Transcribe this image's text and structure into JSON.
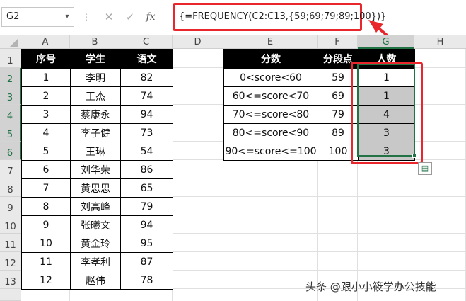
{
  "formula_bar": {
    "name_box": "G2",
    "name_box_arrow": "▾",
    "dots": "⋮",
    "cancel_icon": "✕",
    "enter_icon": "✓",
    "fx_label": "fx",
    "formula": "{=FREQUENCY(C2:C13,{59;69;79;89;100})}"
  },
  "columns": [
    "A",
    "B",
    "C",
    "D",
    "E",
    "F",
    "G",
    "H"
  ],
  "rows": [
    "1",
    "2",
    "3",
    "4",
    "5",
    "6",
    "7",
    "8",
    "9",
    "10",
    "11",
    "12",
    "13"
  ],
  "score_table": {
    "headers": [
      "序号",
      "学生",
      "语文"
    ],
    "rows": [
      [
        "1",
        "李明",
        "82"
      ],
      [
        "2",
        "王杰",
        "74"
      ],
      [
        "3",
        "蔡康永",
        "94"
      ],
      [
        "4",
        "李子健",
        "73"
      ],
      [
        "5",
        "王琳",
        "54"
      ],
      [
        "6",
        "刘华荣",
        "86"
      ],
      [
        "7",
        "黄思思",
        "65"
      ],
      [
        "8",
        "刘高峰",
        "79"
      ],
      [
        "9",
        "张曦文",
        "94"
      ],
      [
        "10",
        "黄金玲",
        "95"
      ],
      [
        "11",
        "李孝利",
        "87"
      ],
      [
        "12",
        "赵伟",
        "78"
      ]
    ]
  },
  "freq_table": {
    "headers": [
      "分数",
      "分段点",
      "人数"
    ],
    "rows": [
      [
        "0<score<60",
        "59",
        "1"
      ],
      [
        "60<=score<70",
        "69",
        "1"
      ],
      [
        "70<=score<80",
        "79",
        "4"
      ],
      [
        "80<=score<90",
        "89",
        "3"
      ],
      [
        "90<=score<=100",
        "100",
        "3"
      ]
    ]
  },
  "quick_analysis_icon": "▤",
  "watermark": "头条 @跟小小筱学办公技能",
  "colors": {
    "accent": "#217346",
    "annotation": "#e8262b",
    "header_fill": "#000000",
    "result_fill": "#c8c8c8"
  }
}
